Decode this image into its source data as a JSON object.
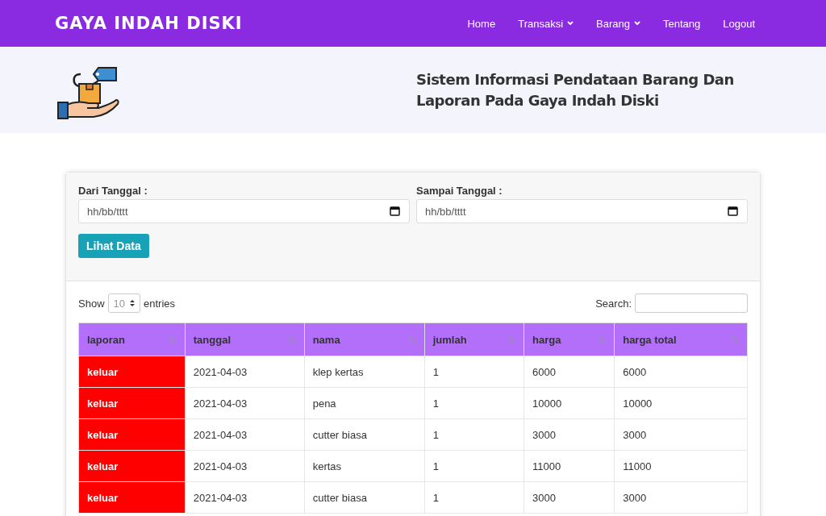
{
  "navbar": {
    "brand": "GAYA INDAH DISKI",
    "links": [
      {
        "label": "Home",
        "dropdown": false
      },
      {
        "label": "Transaksi",
        "dropdown": true
      },
      {
        "label": "Barang",
        "dropdown": true
      },
      {
        "label": "Tentang",
        "dropdown": false
      },
      {
        "label": "Logout",
        "dropdown": false
      }
    ]
  },
  "header": {
    "title": "Sistem Informasi Pendataan Barang Dan Laporan Pada Gaya Indah Diski"
  },
  "filter": {
    "fields": [
      {
        "label": "Dari Tanggal :",
        "placeholder": "hh/bb/tttt"
      },
      {
        "label": "Sampai Tanggal :",
        "placeholder": "hh/bb/tttt"
      }
    ],
    "button": "Lihat Data"
  },
  "table_controls": {
    "show_label": "Show",
    "page_length": "10",
    "entries_label": "entries",
    "search_label": "Search:"
  },
  "table": {
    "columns": [
      "laporan",
      "tanggal",
      "nama",
      "jumlah",
      "harga",
      "harga total"
    ],
    "rows": [
      [
        "keluar",
        "2021-04-03",
        "klep kertas",
        "1",
        "6000",
        "6000"
      ],
      [
        "keluar",
        "2021-04-03",
        "pena",
        "1",
        "10000",
        "10000"
      ],
      [
        "keluar",
        "2021-04-03",
        "cutter biasa",
        "1",
        "3000",
        "3000"
      ],
      [
        "keluar",
        "2021-04-03",
        "kertas",
        "1",
        "11000",
        "11000"
      ],
      [
        "keluar",
        "2021-04-03",
        "cutter biasa",
        "1",
        "3000",
        "3000"
      ]
    ]
  }
}
